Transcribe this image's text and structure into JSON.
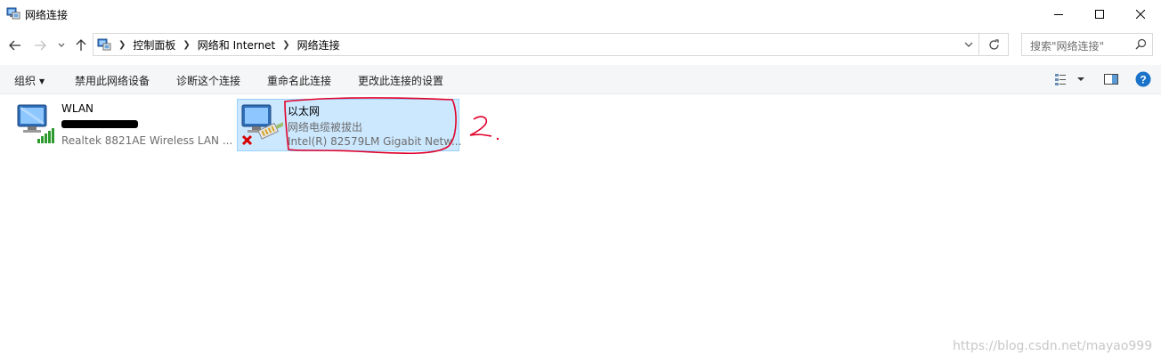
{
  "window": {
    "title": "网络连接"
  },
  "breadcrumb": [
    "控制面板",
    "网络和 Internet",
    "网络连接"
  ],
  "search": {
    "placeholder": "搜索\"网络连接\""
  },
  "toolbar": {
    "organize": "组织",
    "disable": "禁用此网络设备",
    "diagnose": "诊断这个连接",
    "rename": "重命名此连接",
    "change": "更改此连接的设置"
  },
  "connections": [
    {
      "name": "WLAN",
      "status": "",
      "adapter": "Realtek 8821AE Wireless LAN ...",
      "signal_bars": 5,
      "status_redacted": true
    },
    {
      "name": "以太网",
      "status": "网络电缆被拔出",
      "adapter": "Intel(R) 82579LM Gigabit Netw...",
      "disconnected": true,
      "selected": true
    }
  ],
  "annotation": {
    "text": "2.",
    "color": "#e0002a"
  },
  "watermark": "https://blog.csdn.net/mayao999",
  "colors": {
    "selection": "#cce8ff",
    "selection_border": "#99d1ff",
    "help": "#1a73c8"
  }
}
